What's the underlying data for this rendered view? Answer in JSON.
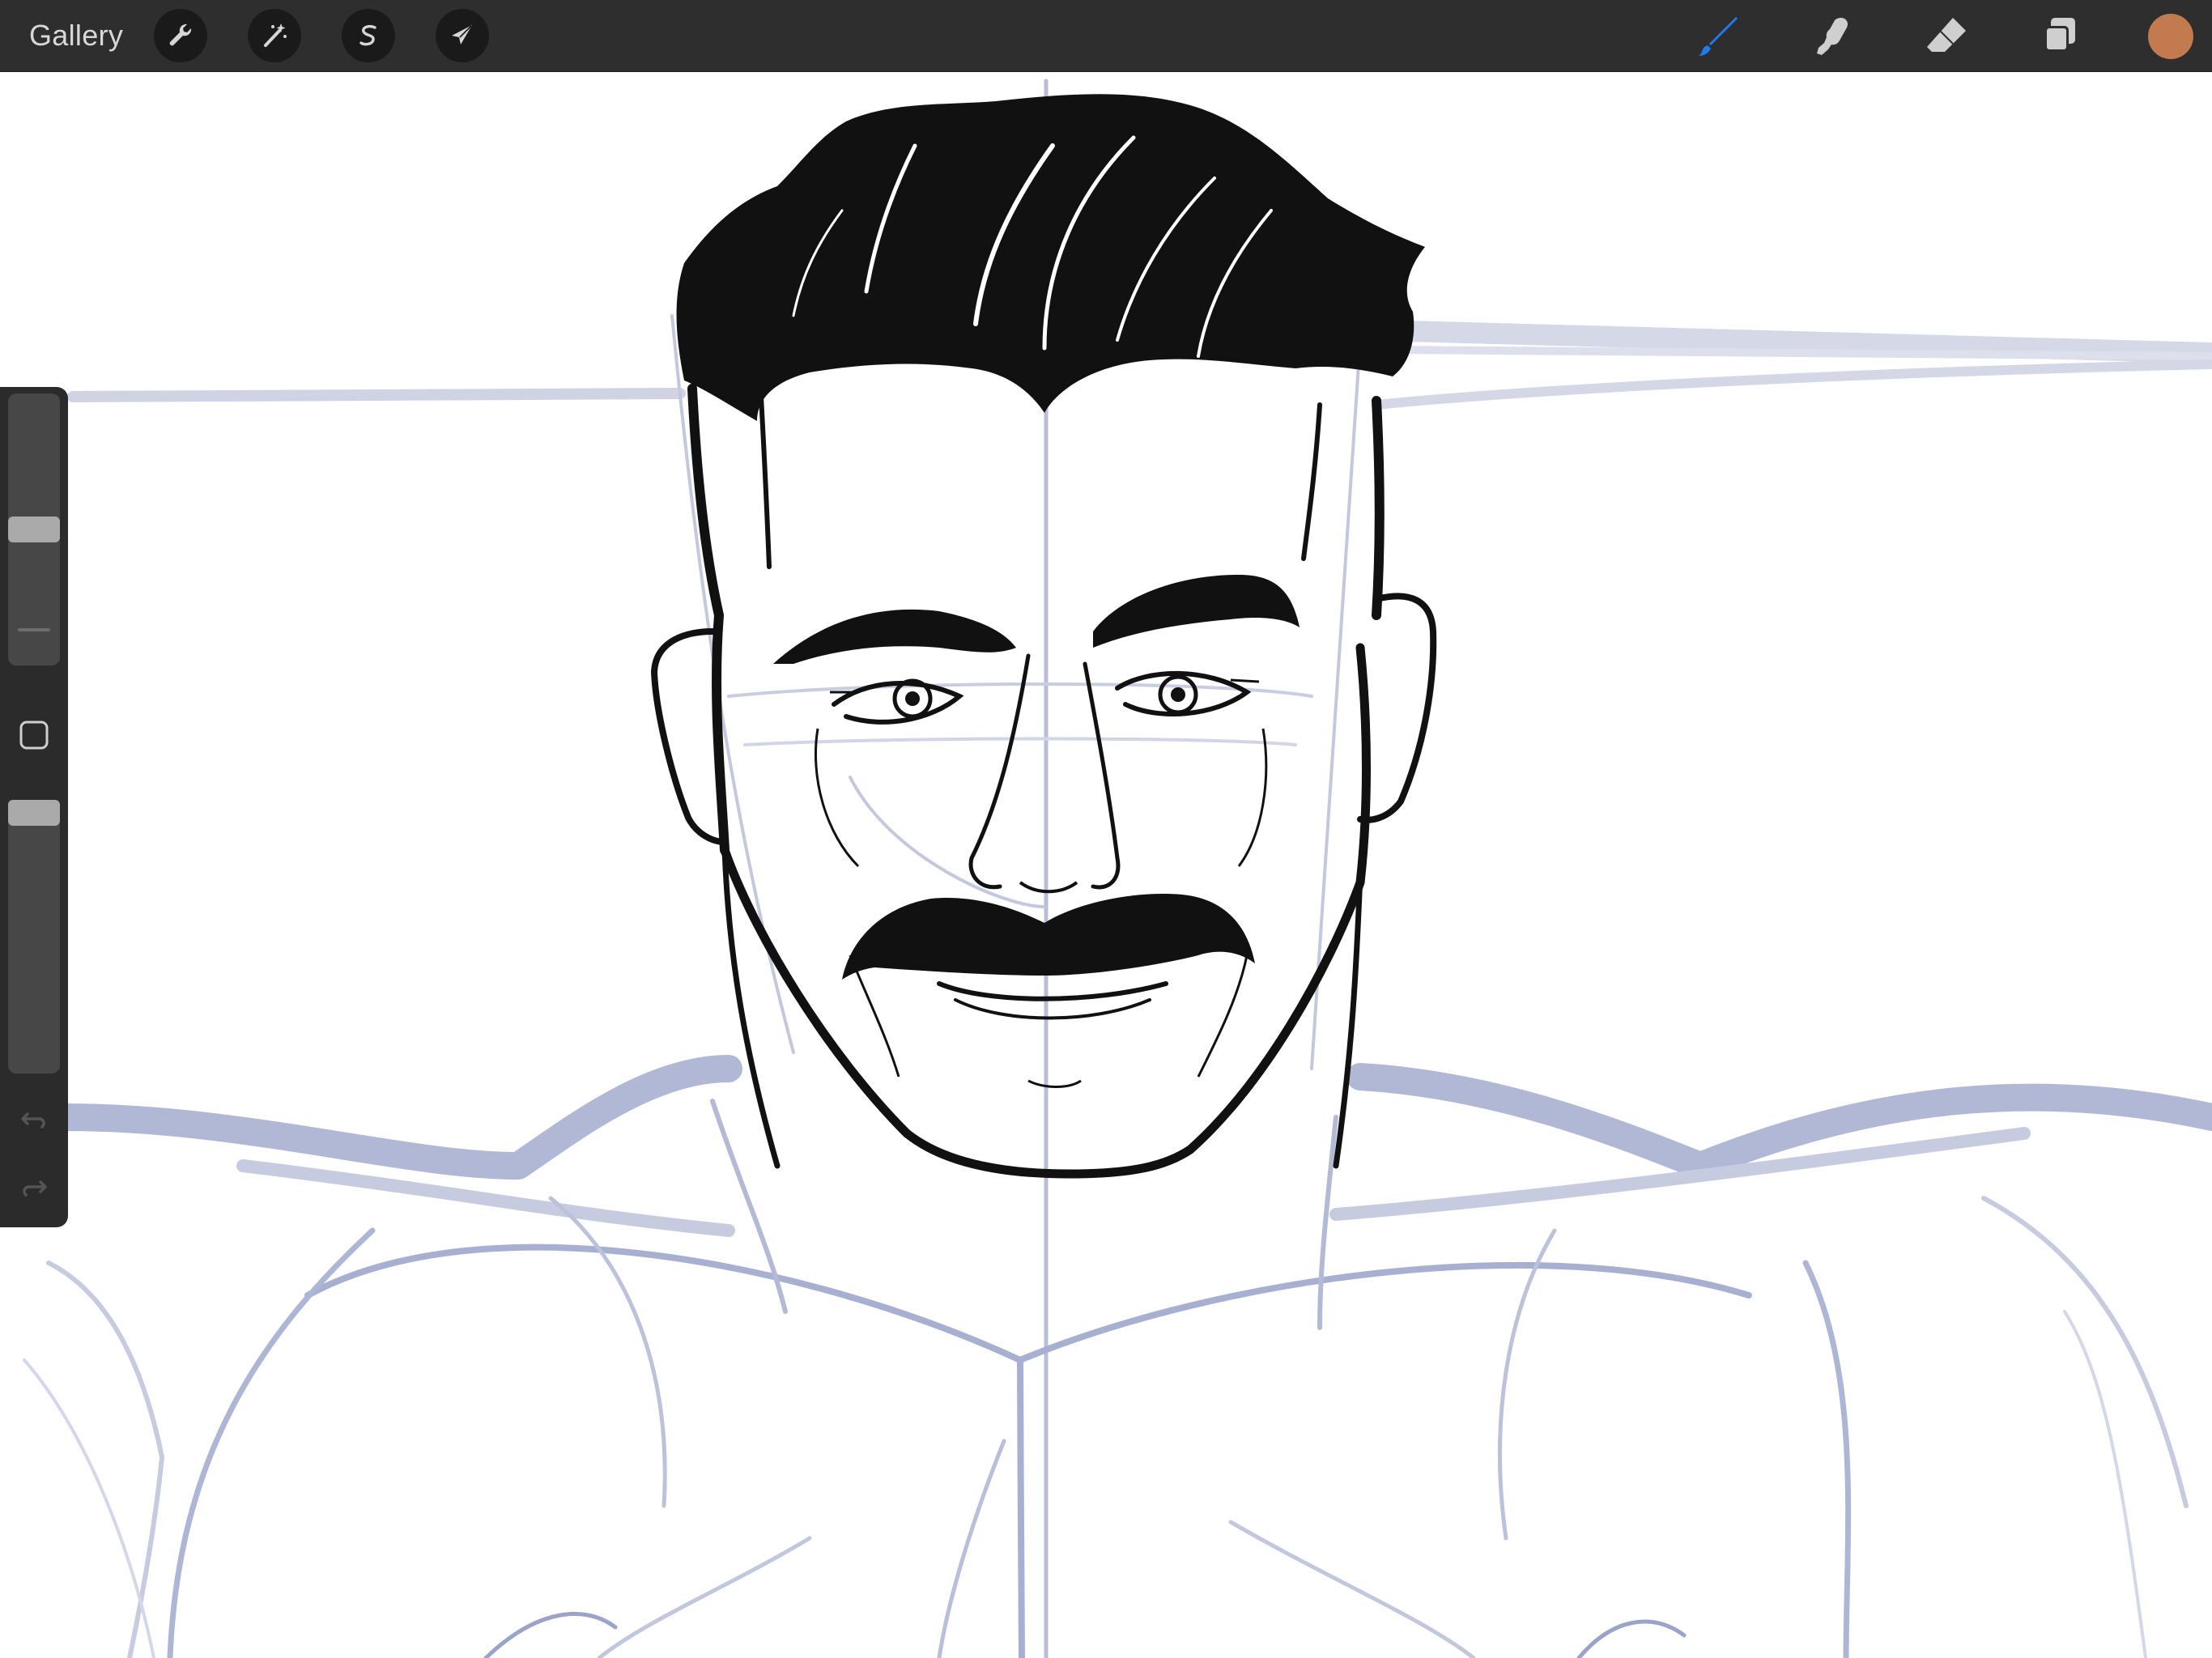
{
  "topbar": {
    "gallery_label": "Gallery",
    "left_tools": [
      {
        "name": "actions",
        "icon": "wrench-icon"
      },
      {
        "name": "adjustments",
        "icon": "magic-wand-icon"
      },
      {
        "name": "selection",
        "icon": "selection-s-icon"
      },
      {
        "name": "transform",
        "icon": "arrow-cursor-icon"
      }
    ],
    "right_tools": [
      {
        "name": "brush",
        "icon": "brush-icon",
        "active": true
      },
      {
        "name": "smudge",
        "icon": "smudge-finger-icon",
        "active": false
      },
      {
        "name": "eraser",
        "icon": "eraser-icon",
        "active": false
      },
      {
        "name": "layers",
        "icon": "layers-icon",
        "active": false
      }
    ],
    "current_color": "#c47a4f"
  },
  "sidebar": {
    "brush_size": 0.5,
    "opacity": 1.0,
    "modify_button_icon": "square-outline-icon",
    "undo_icon": "undo-arrow-icon",
    "redo_icon": "redo-arrow-icon"
  },
  "canvas": {
    "subject": "",
    "ink_color": "#111111",
    "sketch_color": "#9aa3c8"
  },
  "colors": {
    "topbar_bg": "#2e2e2e",
    "sidebar_bg": "#2b2b2b",
    "active_tool_blue": "#1e7cf0",
    "inactive_tool": "#cfcfcf"
  }
}
